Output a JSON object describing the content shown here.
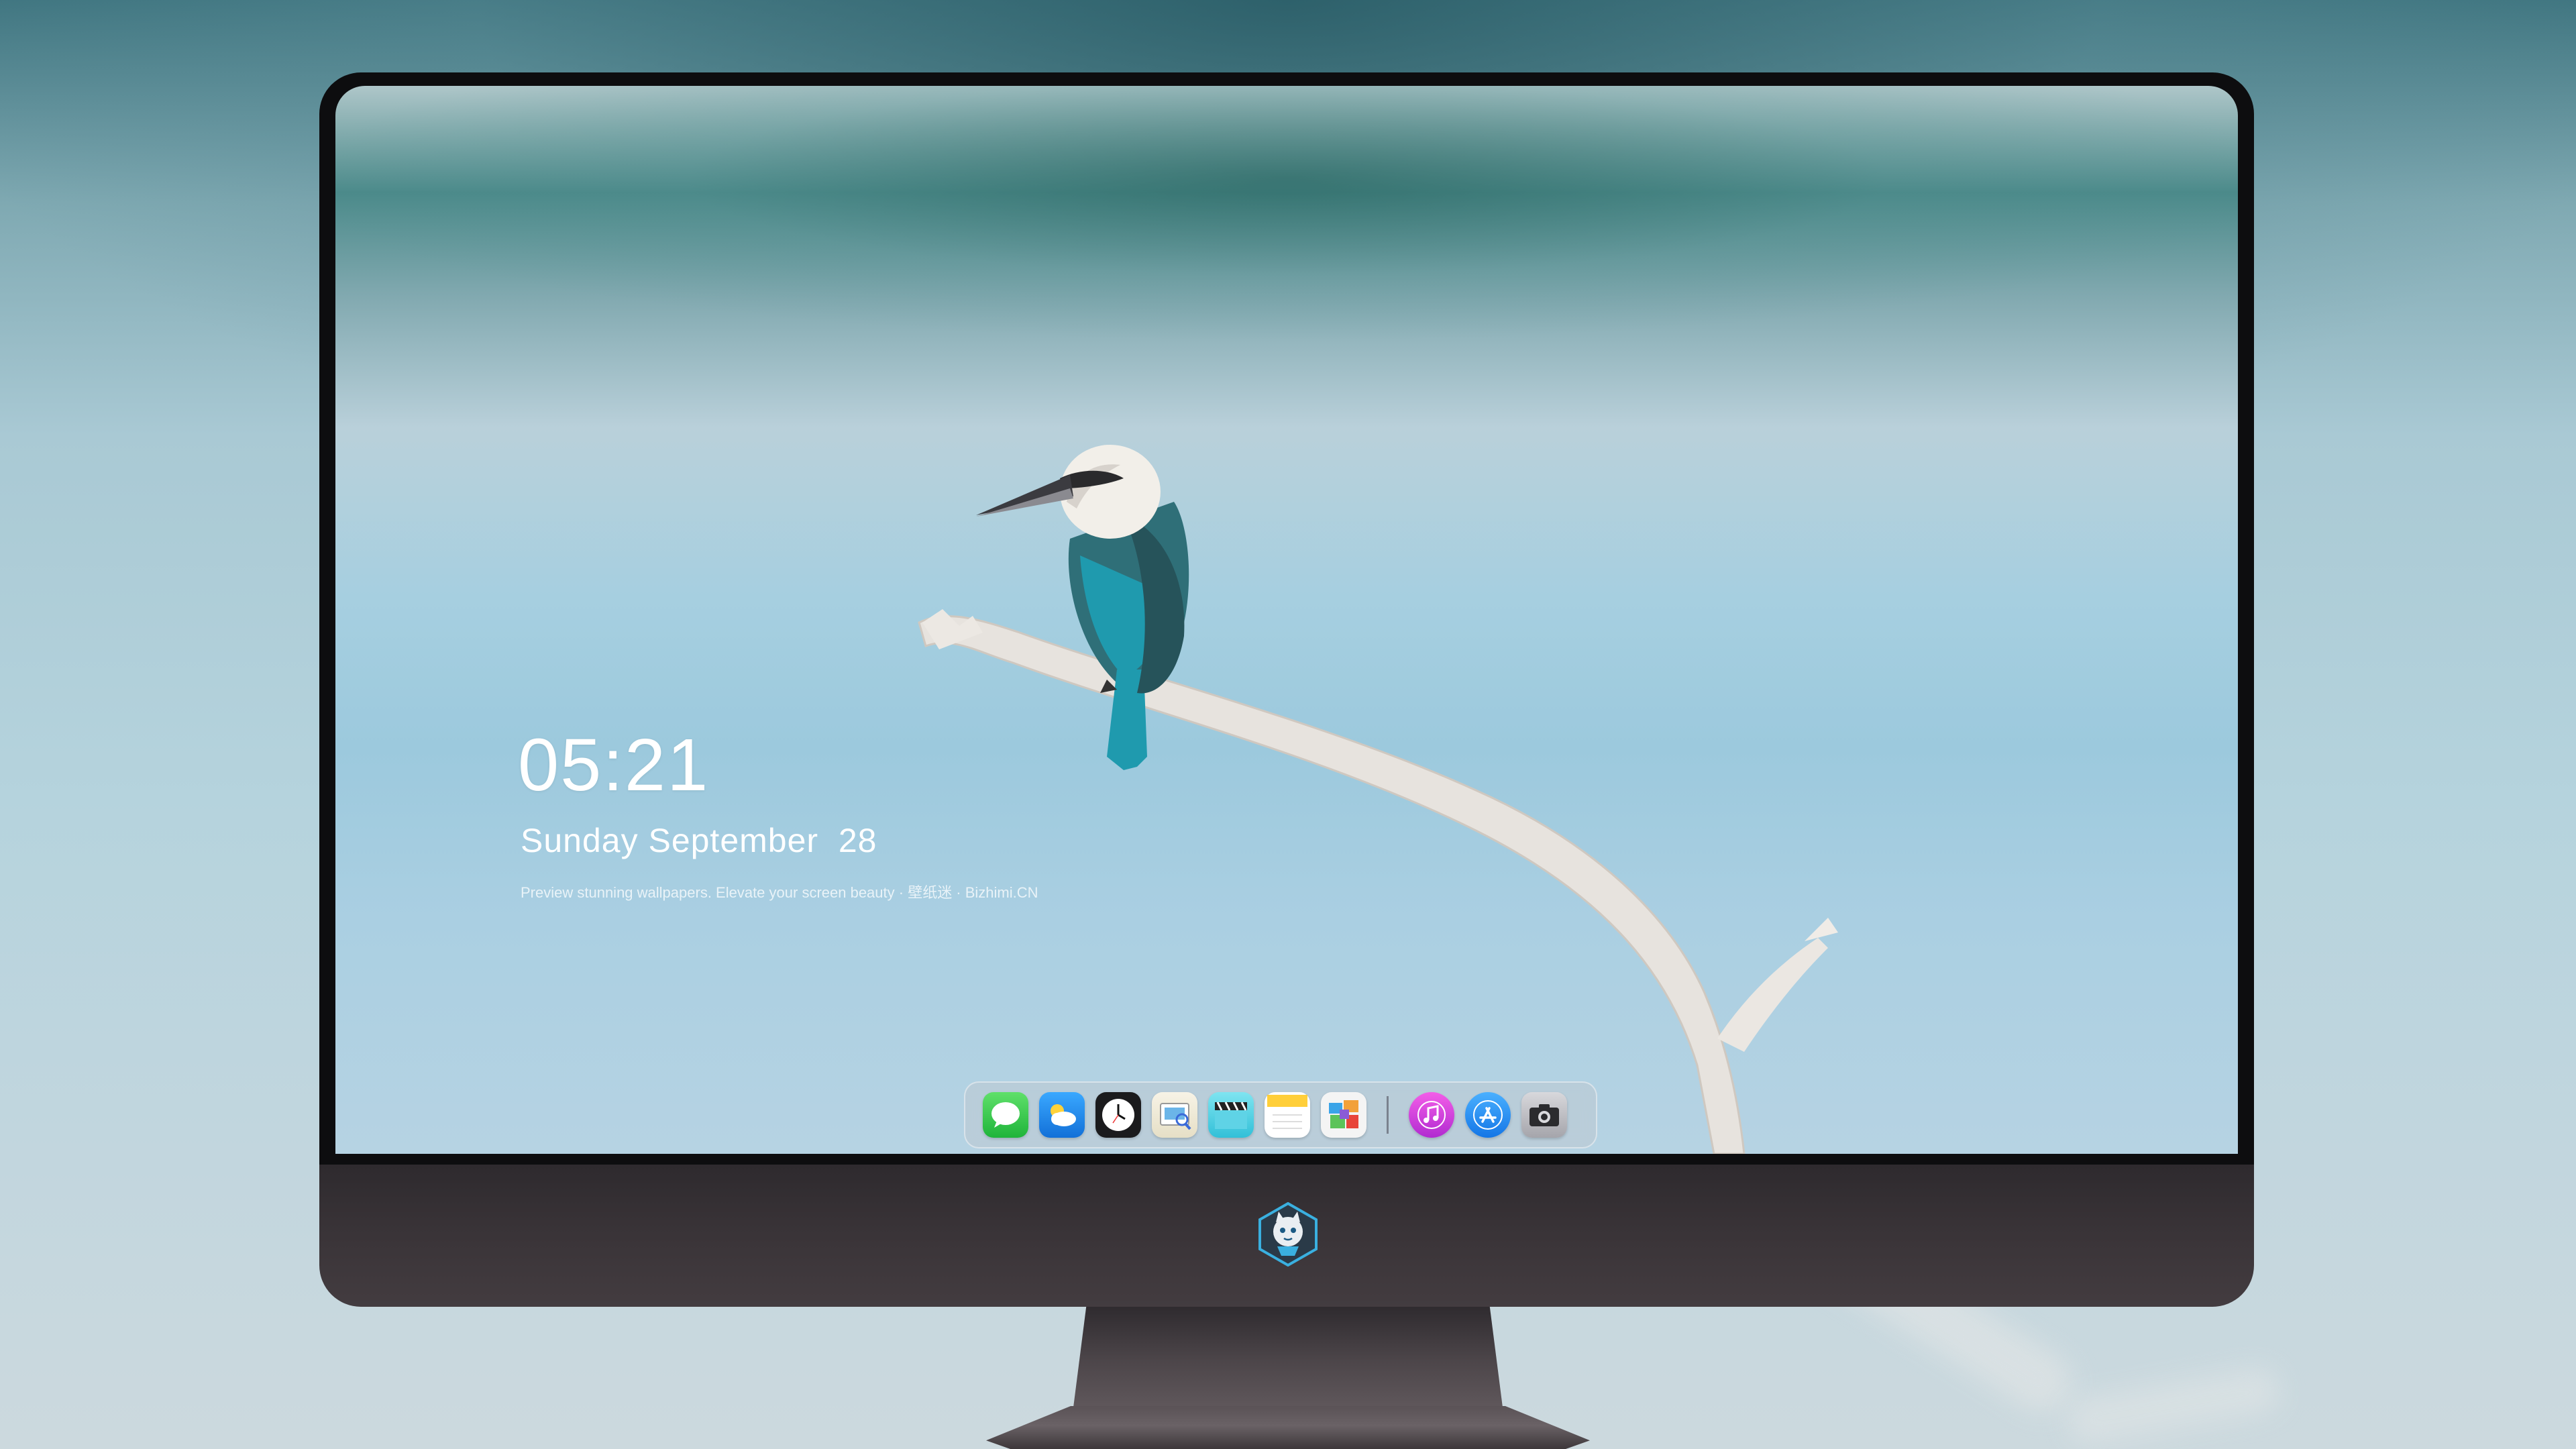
{
  "lockscreen": {
    "time": "05:21",
    "date": "Sunday September  28",
    "tagline": "Preview stunning wallpapers. Elevate your screen beauty · 壁纸迷 · Bizhimi.CN"
  },
  "dock": {
    "apps": [
      {
        "name": "Messages",
        "icon": "messages-icon"
      },
      {
        "name": "Weather",
        "icon": "weather-icon"
      },
      {
        "name": "Clock",
        "icon": "clock-icon"
      },
      {
        "name": "Preview",
        "icon": "preview-icon"
      },
      {
        "name": "Clips",
        "icon": "clapperboard-icon"
      },
      {
        "name": "Notes",
        "icon": "notes-icon"
      },
      {
        "name": "Photos",
        "icon": "photos-icon"
      },
      {
        "name": "iTunes",
        "icon": "music-icon"
      },
      {
        "name": "App Store",
        "icon": "app-store-icon"
      },
      {
        "name": "Camera",
        "icon": "camera-icon"
      }
    ]
  },
  "colors": {
    "messages": "#39c54a",
    "weather": "#1e8ff0",
    "itunes": "#e13fd6",
    "appstore": "#1a8cf6"
  }
}
